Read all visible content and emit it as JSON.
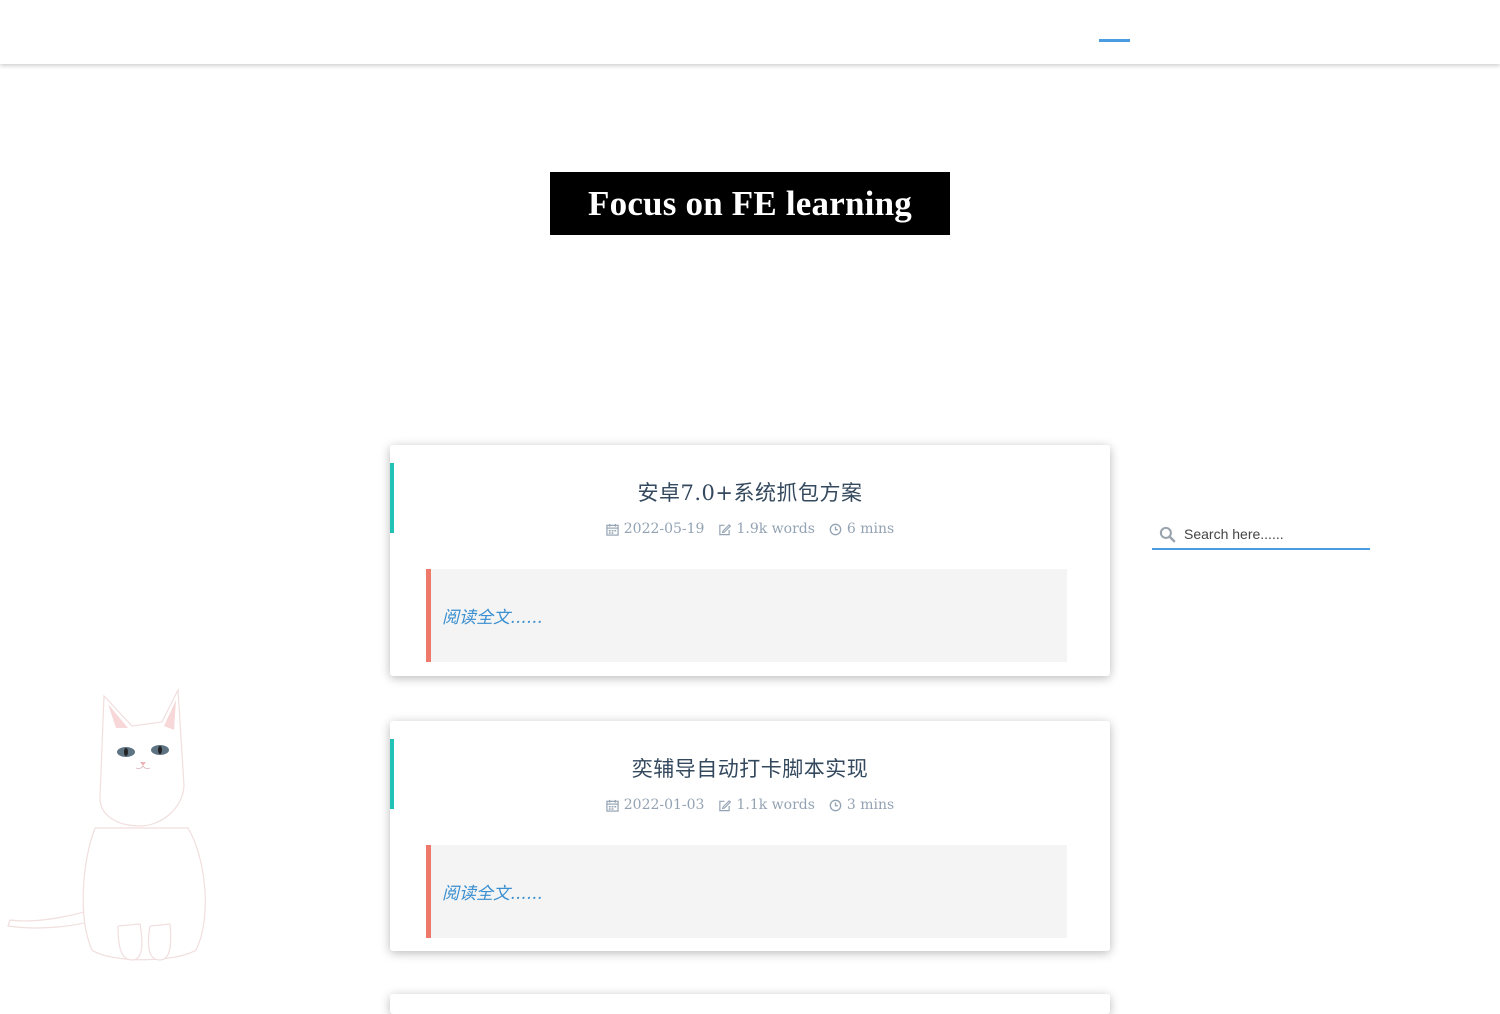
{
  "header": {
    "hero_title": "Focus on FE learning"
  },
  "posts": [
    {
      "title": "安卓7.0+系统抓包方案",
      "date": "2022-05-19",
      "words": "1.9k words",
      "read_time": "6 mins",
      "read_more": "阅读全文......"
    },
    {
      "title": "奕辅导自动打卡脚本实现",
      "date": "2022-01-03",
      "words": "1.1k words",
      "read_time": "3 mins",
      "read_more": "阅读全文......"
    }
  ],
  "search": {
    "placeholder": "Search here......"
  },
  "colors": {
    "nav_active": "#4a9be0",
    "card_accent": "#20c3b5",
    "excerpt_border": "#ee7869",
    "read_more": "#3a8fd0"
  },
  "icons": {
    "date": "calendar-icon",
    "words": "edit-icon",
    "time": "clock-icon",
    "search": "search-icon"
  }
}
